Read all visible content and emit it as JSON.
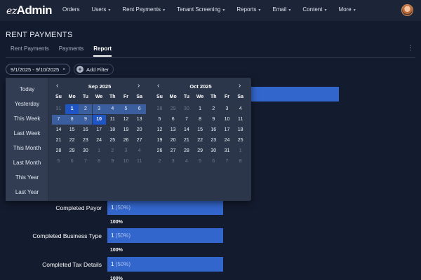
{
  "brand": {
    "prefix": "ez",
    "name": "Admin"
  },
  "nav": [
    {
      "label": "Orders",
      "caret": false
    },
    {
      "label": "Users",
      "caret": true
    },
    {
      "label": "Rent Payments",
      "caret": true
    },
    {
      "label": "Tenant Screening",
      "caret": true
    },
    {
      "label": "Reports",
      "caret": true
    },
    {
      "label": "Email",
      "caret": true
    },
    {
      "label": "Content",
      "caret": true
    },
    {
      "label": "More",
      "caret": true
    }
  ],
  "page": {
    "title": "RENT PAYMENTS",
    "tabs": [
      "Rent Payments",
      "Payments",
      "Report"
    ],
    "active_tab": "Report",
    "more_icon": "⋮"
  },
  "filters": {
    "date_range": "9/1/2025 - 9/10/2025",
    "clear_icon": "×",
    "add_filter_label": "Add Filter",
    "add_icon": "+"
  },
  "datepicker": {
    "presets": [
      "Today",
      "Yesterday",
      "This Week",
      "Last Week",
      "This Month",
      "Last Month",
      "This Year",
      "Last Year"
    ],
    "weekdays": [
      "Su",
      "Mo",
      "Tu",
      "We",
      "Th",
      "Fr",
      "Sa"
    ],
    "prev_icon": "‹",
    "next_icon": "›",
    "months": [
      {
        "title": "Sep 2025",
        "rows": [
          [
            "31",
            "1",
            "2",
            "3",
            "4",
            "5",
            "6"
          ],
          [
            "7",
            "8",
            "9",
            "10",
            "11",
            "12",
            "13"
          ],
          [
            "14",
            "15",
            "16",
            "17",
            "18",
            "19",
            "20"
          ],
          [
            "21",
            "22",
            "23",
            "24",
            "25",
            "26",
            "27"
          ],
          [
            "28",
            "29",
            "30",
            "1",
            "2",
            "3",
            "4"
          ],
          [
            "5",
            "6",
            "7",
            "8",
            "9",
            "10",
            "11"
          ]
        ],
        "muted": [
          [
            0,
            0
          ],
          [
            4,
            3
          ],
          [
            4,
            4
          ],
          [
            4,
            5
          ],
          [
            4,
            6
          ],
          [
            5,
            0
          ],
          [
            5,
            1
          ],
          [
            5,
            2
          ],
          [
            5,
            3
          ],
          [
            5,
            4
          ],
          [
            5,
            5
          ],
          [
            5,
            6
          ]
        ],
        "range": [
          [
            0,
            1
          ],
          [
            0,
            2
          ],
          [
            0,
            3
          ],
          [
            0,
            4
          ],
          [
            0,
            5
          ],
          [
            0,
            6
          ],
          [
            1,
            0
          ],
          [
            1,
            1
          ],
          [
            1,
            2
          ],
          [
            1,
            3
          ]
        ],
        "endpoints": [
          [
            0,
            1
          ],
          [
            1,
            3
          ]
        ]
      },
      {
        "title": "Oct 2025",
        "rows": [
          [
            "28",
            "29",
            "30",
            "1",
            "2",
            "3",
            "4"
          ],
          [
            "5",
            "6",
            "7",
            "8",
            "9",
            "10",
            "11"
          ],
          [
            "12",
            "13",
            "14",
            "15",
            "16",
            "17",
            "18"
          ],
          [
            "19",
            "20",
            "21",
            "22",
            "23",
            "24",
            "25"
          ],
          [
            "26",
            "27",
            "28",
            "29",
            "30",
            "31",
            "1"
          ],
          [
            "2",
            "3",
            "4",
            "5",
            "6",
            "7",
            "8"
          ]
        ],
        "muted": [
          [
            0,
            0
          ],
          [
            0,
            1
          ],
          [
            0,
            2
          ],
          [
            4,
            6
          ],
          [
            5,
            0
          ],
          [
            5,
            1
          ],
          [
            5,
            2
          ],
          [
            5,
            3
          ],
          [
            5,
            4
          ],
          [
            5,
            5
          ],
          [
            5,
            6
          ]
        ],
        "range": [],
        "endpoints": []
      }
    ]
  },
  "report_rows": [
    {
      "label": "",
      "value": "",
      "pct": "",
      "fill": 1.0,
      "below": ""
    },
    {
      "label": "Completed Payor",
      "value": "1",
      "pct": "(50%)",
      "fill": 0.5,
      "below": "100%"
    },
    {
      "label": "Completed Business Type",
      "value": "1",
      "pct": "(50%)",
      "fill": 0.5,
      "below": "100%"
    },
    {
      "label": "Completed Tax Details",
      "value": "1",
      "pct": "(50%)",
      "fill": 0.5,
      "below": "100%"
    }
  ],
  "colors": {
    "bar": "#3366cc",
    "range": "#3b5e9e",
    "endpoint": "#1e54c4"
  }
}
